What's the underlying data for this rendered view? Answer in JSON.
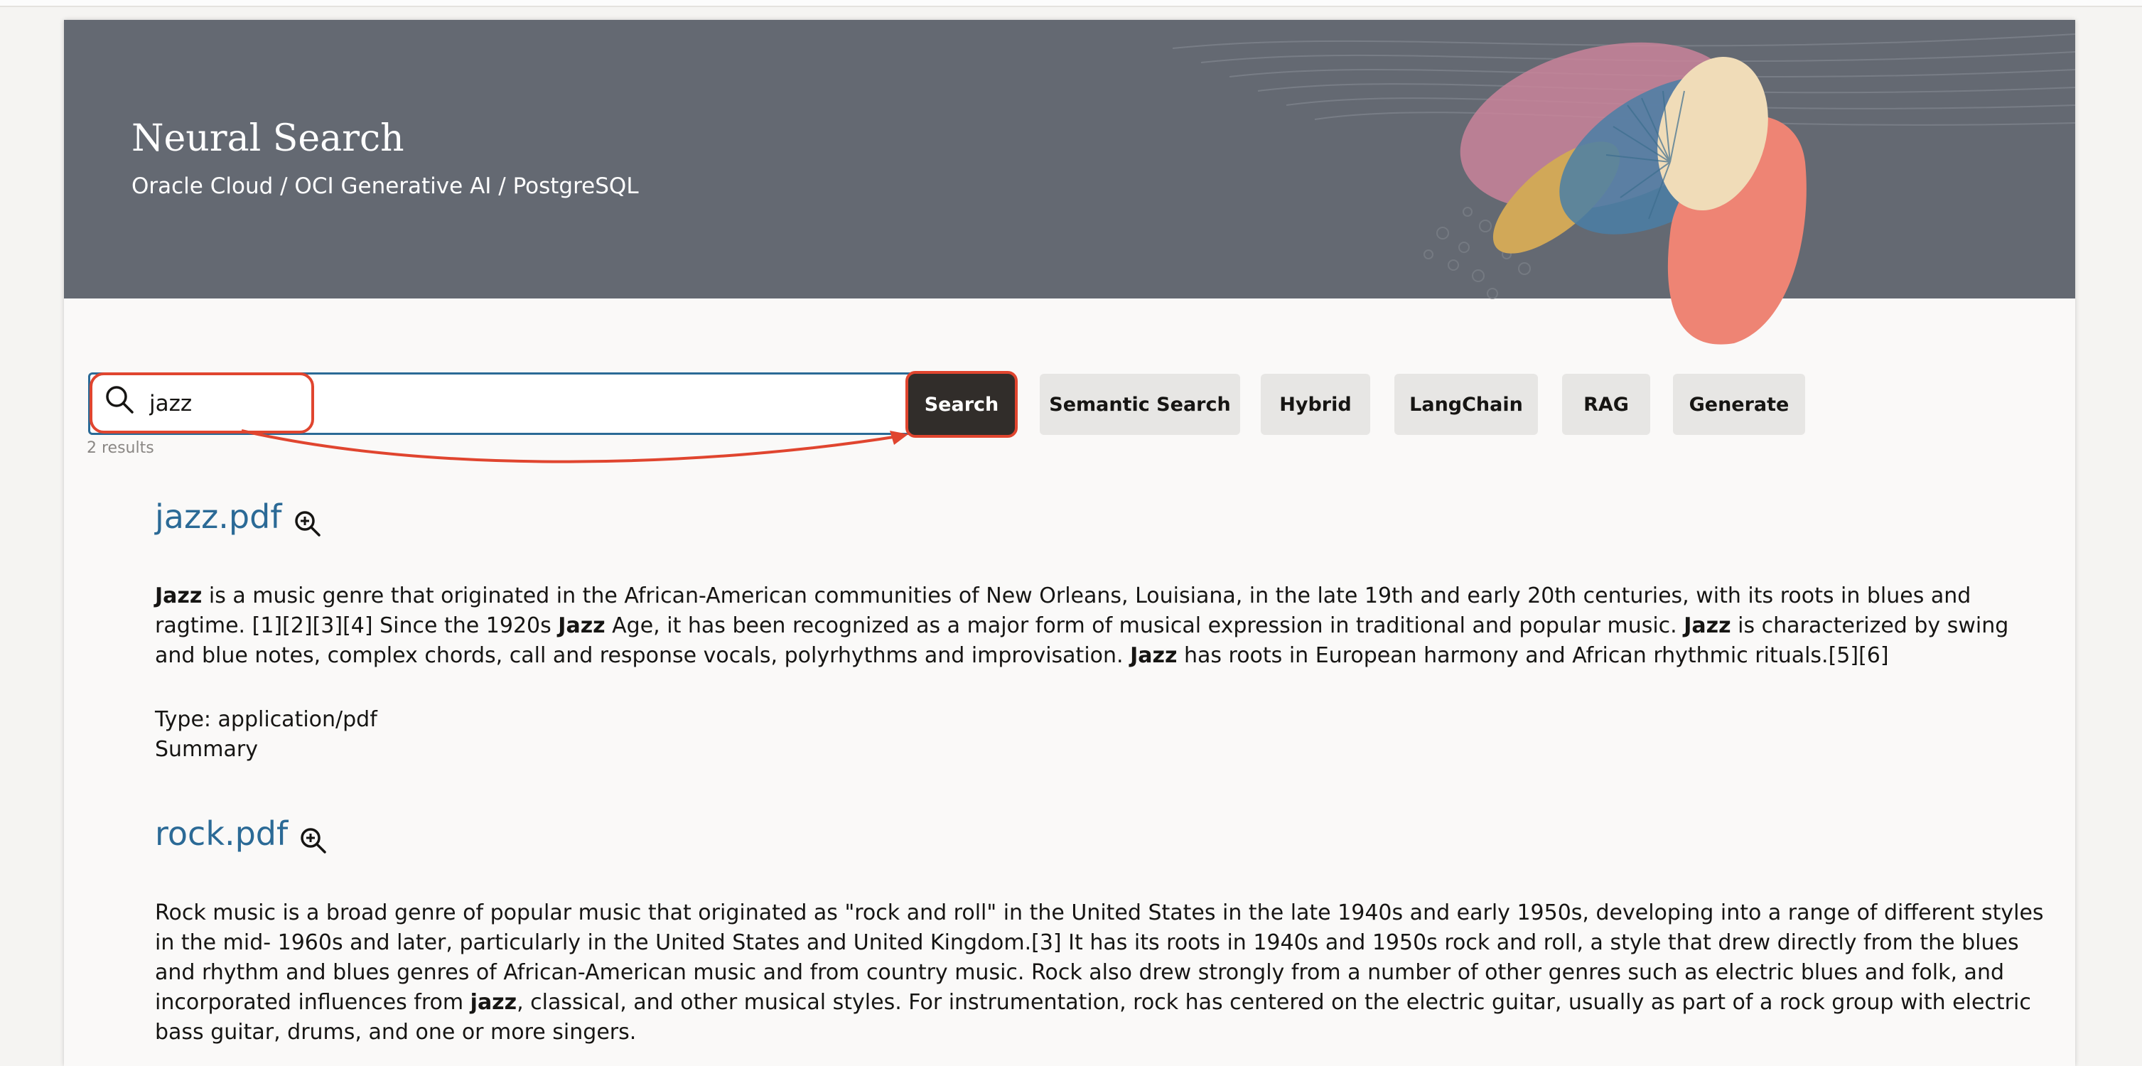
{
  "header": {
    "title": "Neural Search",
    "subtitle": "Oracle Cloud / OCI Generative AI / PostgreSQL"
  },
  "search": {
    "value": "jazz",
    "results_count": "2 results"
  },
  "buttons": {
    "search": "Search",
    "semantic": "Semantic Search",
    "hybrid": "Hybrid",
    "langchain": "LangChain",
    "rag": "RAG",
    "generate": "Generate"
  },
  "results": [
    {
      "title": "jazz.pdf",
      "body_parts": [
        {
          "text": "Jazz",
          "bold": true
        },
        {
          "text": " is a music genre that originated in the African-American communities of New Orleans, Louisiana, in the late 19th and early 20th centuries, with its roots in blues and ragtime. [1][2][3][4] Since the 1920s ",
          "bold": false
        },
        {
          "text": "Jazz",
          "bold": true
        },
        {
          "text": " Age, it has been recognized as a major form of musical expression in traditional and popular music. ",
          "bold": false
        },
        {
          "text": "Jazz",
          "bold": true
        },
        {
          "text": " is characterized by swing and blue notes, complex chords, call and response vocals, polyrhythms and improvisation. ",
          "bold": false
        },
        {
          "text": "Jazz",
          "bold": true
        },
        {
          "text": " has roots in European harmony and African rhythmic rituals.[5][6]",
          "bold": false
        }
      ],
      "type": "Type: application/pdf",
      "summary": "Summary"
    },
    {
      "title": "rock.pdf",
      "body_parts": [
        {
          "text": "Rock music is a broad genre of popular music that originated as \"rock and roll\" in the United States in the late 1940s and early 1950s, developing into a range of different styles in the mid- 1960s and later, particularly in the United States and United Kingdom.[3] It has its roots in 1940s and 1950s rock and roll, a style that drew directly from the blues and rhythm and blues genres of African-American music and from country music. Rock also drew strongly from a number of other genres such as electric blues and folk, and incorporated influences from ",
          "bold": false
        },
        {
          "text": "jazz",
          "bold": true
        },
        {
          "text": ", classical, and other musical styles. For instrumentation, rock has centered on the electric guitar, usually as part of a rock group with electric bass guitar, drums, and one or more singers.",
          "bold": false
        }
      ]
    }
  ],
  "icons": {
    "search": "search-icon",
    "zoom": "zoom-in-icon"
  },
  "colors": {
    "banner": "#646972",
    "link": "#2b6a96",
    "primary_button": "#312d2a",
    "annotation": "#e0452f"
  }
}
